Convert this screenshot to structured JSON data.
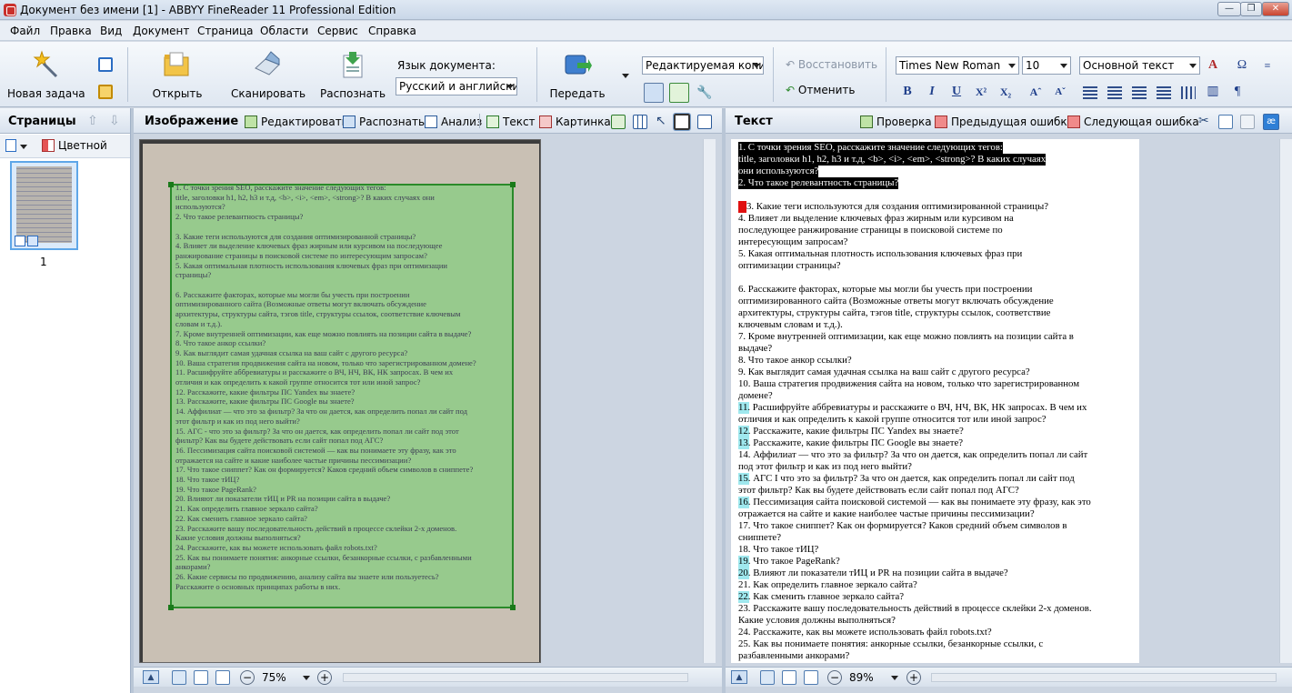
{
  "window": {
    "title": "Документ без имени [1] - ABBYY FineReader 11 Professional Edition"
  },
  "menu": [
    "Файл",
    "Правка",
    "Вид",
    "Документ",
    "Страница",
    "Области",
    "Сервис",
    "Справка"
  ],
  "toolbar": {
    "new_task": "Новая задача",
    "open": "Открыть",
    "scan": "Сканировать",
    "recognize": "Распознать",
    "doc_lang_label": "Язык документа:",
    "doc_lang_value": "Русский и английски",
    "send": "Передать",
    "output_mode": "Редактируемая копи",
    "restore": "Восстановить",
    "undo": "Отменить",
    "font": "Times New Roman",
    "font_size": "10",
    "style": "Основной текст"
  },
  "pages_panel": {
    "title": "Страницы",
    "color_mode": "Цветной",
    "page_number": "1"
  },
  "image_panel": {
    "title": "Изображение",
    "tools": [
      "Редактировать",
      "Распознать",
      "Анализ",
      "Текст",
      "Картинка"
    ],
    "zoom": "75%"
  },
  "text_panel": {
    "title": "Текст",
    "check": "Проверка",
    "prev_error": "Предыдущая ошибка",
    "next_error": "Следующая ошибка",
    "zoom": "89%"
  },
  "scan_lines": [
    "1.   С точки зрения SEO, расскажите значение следующих тегов:",
    "      title, заголовки h1, h2, h3 и т.д, <b>, <i>, <em>, <strong>? В каких случаях они",
    "      используются?",
    "2.   Что такое релевантность страницы?",
    "",
    "3.   Какие теги используются для создания оптимизированной страницы?",
    "4.   Влияет ли выделение ключевых фраз жирным или курсивом на последующее",
    "      ранжирование страницы в поисковой системе по интересующим запросам?",
    "5.   Какая оптимальная плотность использования ключевых фраз при оптимизации",
    "      страницы?",
    "",
    "6.   Расскажите факторах, которые мы могли бы учесть при построении",
    "      оптимизированного сайта (Возможные ответы могут включать обсуждение",
    "      архитектуры, структуры сайта, тэгов title, структуры ссылок, соответствие ключевым",
    "      словам и т.д.).",
    "7.   Кроме внутренней оптимизации, как еще можно повлиять на позиции сайта в выдаче?",
    "8.   Что такое анкор ссылки?",
    "9.   Как выглядит самая удачная ссылка на ваш сайт с другого ресурса?",
    "10. Ваша стратегия продвижения сайта на новом, только что зарегистрированном домене?",
    "11. Расшифруйте аббревиатуры и расскажите о ВЧ, НЧ, ВК, НК запросах. В чем их",
    "      отличия и как определить к какой группе относится тот или иной запрос?",
    "12. Расскажите, какие фильтры ПС Yandex вы знаете?",
    "13. Расскажите, какие фильтры ПС Google вы знаете?",
    "14. Аффилиат — что это за фильтр? За что он дается, как определить попал ли сайт под",
    "      этот фильтр и как из под него выйти?",
    "15. АГС - что это за фильтр? За что он дается, как определить попал ли сайт под этот",
    "      фильтр? Как вы будете действовать если сайт попал под АГС?",
    "16. Пессимизация сайта  поисковой системой — как вы понимаете эту фразу, как это",
    "      отражается на сайте и какие наиболее частые причины пессимизации?",
    "17. Что такое сниппет? Как он формируется? Каков средний объем символов в сниппете?",
    "18. Что такое тИЦ?",
    "19. Что такое PageRank?",
    "20. Влияют ли показатели тИЦ и PR на позиции сайта в выдаче?",
    "21. Как определить главное зеркало сайта?",
    "22. Как сменить главное зеркало сайта?",
    "23. Расскажите вашу последовательность действий в процессе склейки 2-х доменов.",
    "      Какие условия должны выполняться?",
    "24. Расскажите, как вы можете использовать файл robots.txt?",
    "25. Как вы понимаете понятия: анкорные ссылки, безанкорные ссылки, с разбавленными",
    "      анкорами?",
    "26. Какие сервисы по продвижению, анализу сайта вы знаете или пользуетесь?",
    "      Расскажите о основных принципах работы в них."
  ],
  "text_lines": [
    "1.   С точки зрения SEO, расскажите значение следующих тегов:",
    "      title, заголовки h1, h2, h3 и т.д, <b>, <i>, <em>, <strong>? В каких случаях",
    "      они используются?",
    "2.   Что такое релевантность страницы?",
    "",
    "3.   Какие теги используются для создания оптимизированной страницы?",
    "4.   Влияет ли выделение ключевых фраз жирным или курсивом на",
    "      последующее ранжирование страницы в поисковой системе по",
    "      интересующим запросам?",
    "5.   Какая оптимальная плотность использования ключевых фраз при",
    "      оптимизации страницы?",
    "",
    "6.   Расскажите факторах, которые мы могли бы учесть при построении",
    "      оптимизированного сайта (Возможные ответы могут включать обсуждение",
    "      архитектуры, структуры сайта, тэгов title, структуры ссылок, соответствие",
    "      ключевым словам и т.д.).",
    "7.   Кроме внутренней оптимизации, как еще можно повлиять на позиции сайта в",
    "выдаче?",
    "8.   Что такое анкор ссылки?",
    "9.   Как выглядит самая удачная ссылка на ваш сайт с другого ресурса?",
    "10. Ваша стратегия продвижения сайта на новом, только что зарегистрированном",
    "домене?",
    "11. Расшифруйте аббревиатуры и расскажите о ВЧ, НЧ, ВК, НК запросах. В чем их",
    "      отличия и как определить к какой группе относится тот или иной запрос?",
    "12. Расскажите, какие фильтры ПС Yandex вы знаете?",
    "13. Расскажите, какие фильтры ПС Google вы знаете?",
    "14. Аффилиат — что это за фильтр? За что он дается, как определить попал ли сайт",
    "      под этот фильтр и как из под него выйти?",
    "15. АГС I что это за фильтр? За что он дается, как определить попал ли сайт под",
    "      этот фильтр? Как вы будете действовать если сайт попал под АГС?",
    "16. Пессимизация сайта поисковой системой — как вы понимаете эту фразу, как это",
    "      отражается на сайте и какие наиболее частые причины пессимизации?",
    "17. Что такое сниппет? Как он формируется? Каков средний объем символов в",
    "сниппете?",
    "18. Что такое тИЦ?",
    "19. Что такое PageRank?",
    "20. Влияют ли показатели тИЦ и PR на позиции сайта в выдаче?",
    "21. Как определить главное зеркало сайта?",
    "22. Как сменить главное зеркало сайта?",
    "23. Расскажите вашу последовательность действий в процессе склейки 2-х доменов.",
    "      Какие условия должны выполняться?",
    "24. Расскажите, как вы можете использовать файл robots.txt?",
    "25. Как вы понимаете понятия: анкорные ссылки, безанкорные ссылки, с",
    "      разбавленными анкорами?",
    "26. Какие сервисы по продвижению, анализу сайта вы знаете или"
  ]
}
